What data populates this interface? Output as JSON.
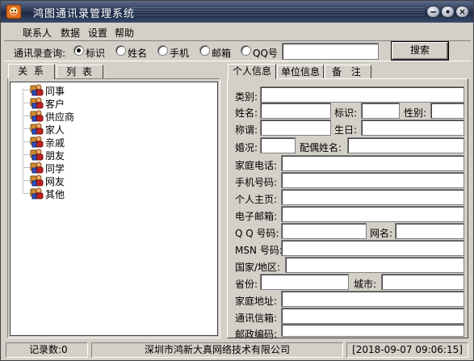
{
  "window": {
    "title": "鸿图通讯录管理系统"
  },
  "menu": [
    {
      "label": "联系人"
    },
    {
      "label": "数据"
    },
    {
      "label": "设置"
    },
    {
      "label": "帮助"
    }
  ],
  "query": {
    "label": "通讯录查询:",
    "options": [
      {
        "label": "标识",
        "checked": true
      },
      {
        "label": "姓名",
        "checked": false
      },
      {
        "label": "手机",
        "checked": false
      },
      {
        "label": "邮箱",
        "checked": false
      },
      {
        "label": "QQ号",
        "checked": false
      }
    ],
    "value": "",
    "search_label": "搜索"
  },
  "left_tabs": [
    {
      "label": "关  系"
    },
    {
      "label": "列  表"
    }
  ],
  "tree": [
    {
      "label": "同事"
    },
    {
      "label": "客户"
    },
    {
      "label": "供应商"
    },
    {
      "label": "家人"
    },
    {
      "label": "亲戚"
    },
    {
      "label": "朋友"
    },
    {
      "label": "同学"
    },
    {
      "label": "网友"
    },
    {
      "label": "其他"
    }
  ],
  "right_tabs": [
    {
      "label": "个人信息"
    },
    {
      "label": "单位信息"
    },
    {
      "label": "备  注"
    }
  ],
  "form": {
    "category": "类别:",
    "name": "姓名:",
    "tag": "标识:",
    "gender": "性别:",
    "title": "称谓:",
    "birthday": "生日:",
    "marital": "婚况:",
    "spouse": "配偶姓名:",
    "home_phone": "家庭电话:",
    "mobile": "手机号码:",
    "homepage": "个人主页:",
    "email": "电子邮箱:",
    "qq": "Q Q 号码:",
    "nickname": "网名:",
    "msn": "MSN 号码:",
    "country": "国家/地区:",
    "province": "省份:",
    "city": "城市:",
    "home_address": "家庭地址:",
    "mail_box": "通讯信箱:",
    "postcode": "邮政编码:"
  },
  "status": {
    "count": "记录数:0",
    "company": "深圳市鸿新大真网络技术有限公司",
    "datetime": "[2018-09-07 09:06:15]"
  },
  "colors": {
    "title_bar": "#2c3a58",
    "face": "#d4d0c8",
    "input_bg": "#ffffff"
  }
}
